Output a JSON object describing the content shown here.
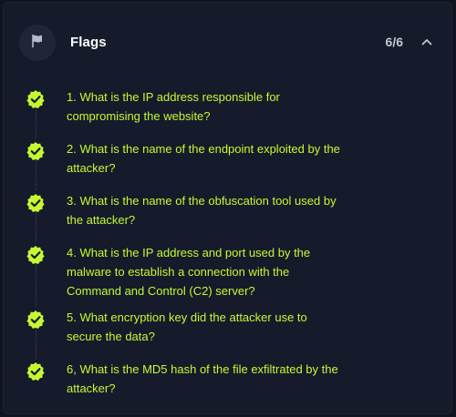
{
  "header": {
    "title": "Flags",
    "count": "6/6",
    "icon": "flag-icon",
    "collapse_icon": "chevron-up-icon"
  },
  "colors": {
    "accent": "#c6f832",
    "panel_bg": "#151b2b",
    "page_bg": "#0f1420",
    "text_muted": "#c2c6d0"
  },
  "flags": [
    {
      "text": "1. What is the IP address responsible for compromising the website?",
      "status": "completed"
    },
    {
      "text": "2. What is the name of the endpoint exploited by the attacker?",
      "status": "completed"
    },
    {
      "text": "3. What is the name of the obfuscation tool used by the attacker?",
      "status": "completed"
    },
    {
      "text": "4. What is the IP address and port used by the malware to establish a connection with the Command and Control (C2) server?",
      "status": "completed"
    },
    {
      "text": "5. What encryption key did the attacker use to secure the data?",
      "status": "completed"
    },
    {
      "text": "6, What is the MD5 hash of the file exfiltrated by the attacker?",
      "status": "completed"
    }
  ]
}
